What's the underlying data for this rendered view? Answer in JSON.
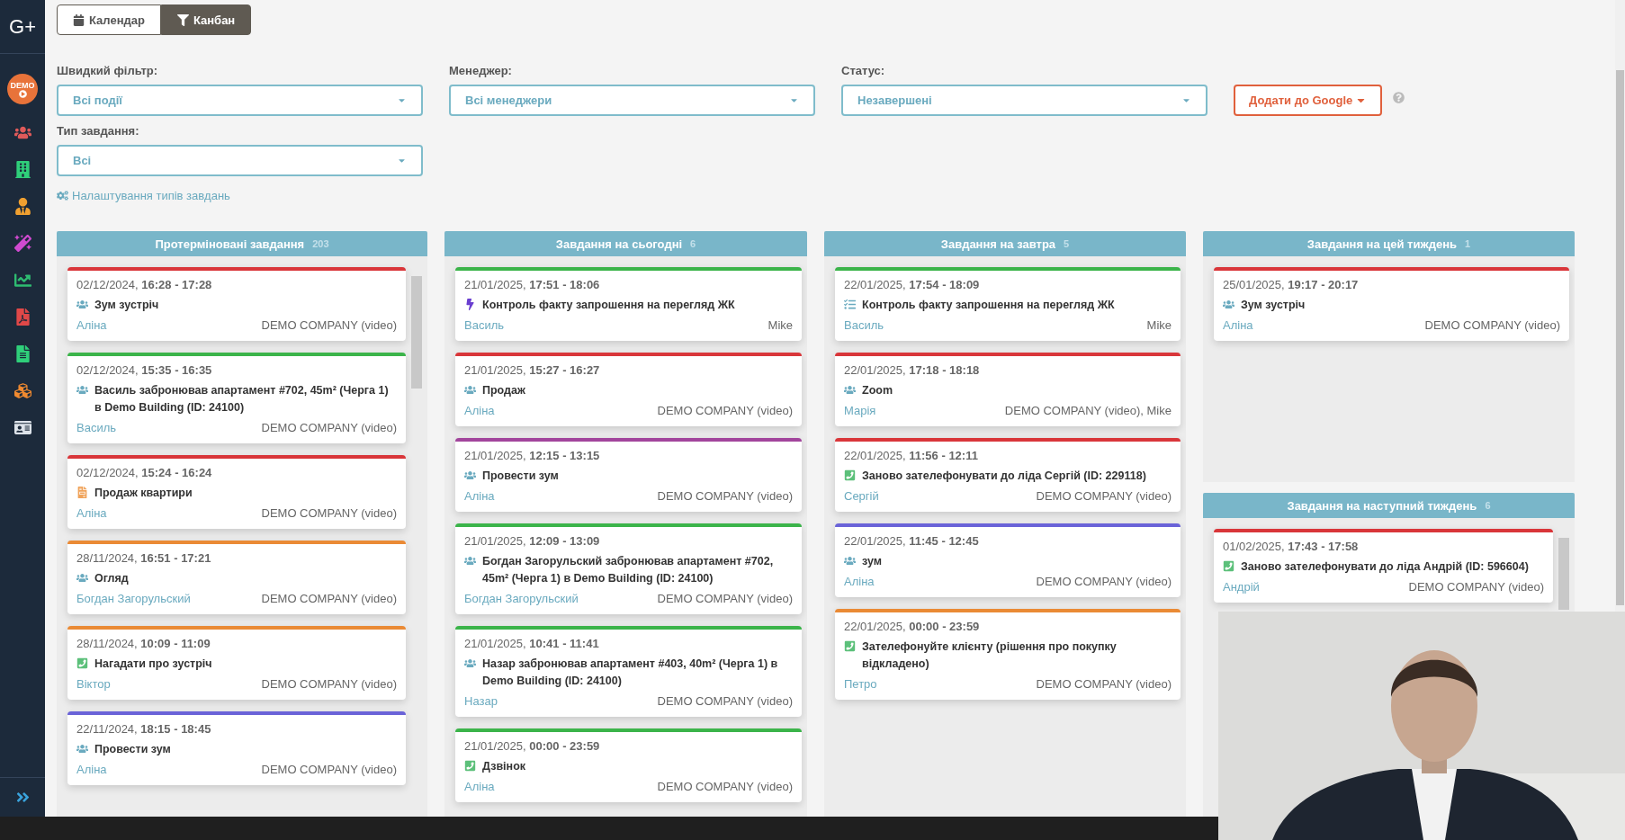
{
  "sidebar": {
    "logo": "G+",
    "avatar": "DEMO"
  },
  "view_toggle": [
    {
      "label": "Календар",
      "kind": "calendar",
      "selected": false
    },
    {
      "label": "Канбан",
      "kind": "filter",
      "selected": true
    }
  ],
  "filters": [
    {
      "label": "Швидкий фільтр:",
      "value": "Всі події"
    },
    {
      "label": "Менеджер:",
      "value": "Всі менеджери"
    },
    {
      "label": "Статус:",
      "value": "Незавершені"
    },
    {
      "label": "Тип завдання:",
      "value": "Всі"
    }
  ],
  "google_button": "Додати до Google",
  "settings_link": "Налаштування типів завдань",
  "columns": [
    {
      "sections": [
        {
          "title": "Протерміновані завдання",
          "count": "203",
          "scrollbar": true,
          "cards": [
            {
              "color": "#d9363a",
              "when": "02/12/2024, **16:28 - 17:28**",
              "kind": "meeting",
              "title": "Зум зустріч",
              "manager": "Аліна",
              "company": "DEMO COMPANY (video)"
            },
            {
              "color": "#3bb44a",
              "when": "02/12/2024, **15:35 - 16:35**",
              "kind": "meeting",
              "title": "Василь забронював апартамент #702, 45m² (Черга 1) в Demo Building (ID: 24100)",
              "manager": "Василь",
              "company": "DEMO COMPANY (video)"
            },
            {
              "color": "#d9363a",
              "when": "02/12/2024, **15:24 - 16:24**",
              "kind": "document",
              "title": "Продаж квартири",
              "manager": "Аліна",
              "company": "DEMO COMPANY (video)"
            },
            {
              "color": "#ea8a35",
              "when": "28/11/2024, **16:51 - 17:21**",
              "kind": "meeting",
              "title": "Огляд",
              "manager": "Богдан Загорульский",
              "company": "DEMO COMPANY (video)"
            },
            {
              "color": "#ea8a35",
              "when": "28/11/2024, **10:09 - 11:09**",
              "kind": "call",
              "title": "Нагадати про зустріч",
              "manager": "Віктор",
              "company": "DEMO COMPANY (video)"
            },
            {
              "color": "#6a63d8",
              "when": "22/11/2024, **18:15 - 18:45**",
              "kind": "meeting",
              "title": "Провести зум",
              "manager": "Аліна",
              "company": "DEMO COMPANY (video)"
            }
          ]
        }
      ]
    },
    {
      "sections": [
        {
          "title": "Завдання на сьогодні",
          "count": "6",
          "scrollbar": false,
          "cards": [
            {
              "color": "#3bb44a",
              "when": "21/01/2025, **17:51 - 18:06**",
              "kind": "bolt",
              "title": "Контроль факту запрошення на перегляд ЖК",
              "manager": "Василь",
              "company": "Mike"
            },
            {
              "color": "#d9363a",
              "when": "21/01/2025, **15:27 - 16:27**",
              "kind": "meeting",
              "title": "Продаж",
              "manager": "Аліна",
              "company": "DEMO COMPANY (video)"
            },
            {
              "color": "#a2459c",
              "when": "21/01/2025, **12:15 - 13:15**",
              "kind": "meeting",
              "title": "Провести зум",
              "manager": "Аліна",
              "company": "DEMO COMPANY (video)"
            },
            {
              "color": "#3bb44a",
              "when": "21/01/2025, **12:09 - 13:09**",
              "kind": "meeting",
              "title": "Богдан Загорульский забронював апартамент #702, 45m² (Черга 1) в Demo Building (ID: 24100)",
              "manager": "Богдан Загорульский",
              "company": "DEMO COMPANY (video)"
            },
            {
              "color": "#3bb44a",
              "when": "21/01/2025, **10:41 - 11:41**",
              "kind": "meeting",
              "title": "Назар забронював апартамент #403, 40m² (Черга 1) в Demo Building (ID: 24100)",
              "manager": "Назар",
              "company": "DEMO COMPANY (video)"
            },
            {
              "color": "#3bb44a",
              "when": "21/01/2025, **00:00 - 23:59**",
              "kind": "call",
              "title": "Дзвінок",
              "manager": "Аліна",
              "company": "DEMO COMPANY (video)"
            }
          ]
        }
      ]
    },
    {
      "sections": [
        {
          "title": "Завдання на завтра",
          "count": "5",
          "scrollbar": false,
          "cards": [
            {
              "color": "#3bb44a",
              "when": "22/01/2025, **17:54 - 18:09**",
              "kind": "list",
              "title": "Контроль факту запрошення на перегляд ЖК",
              "manager": "Василь",
              "company": "Mike"
            },
            {
              "color": "#d9363a",
              "when": "22/01/2025, **17:18 - 18:18**",
              "kind": "meeting",
              "title": "Zoom",
              "manager": "Марія",
              "company": "DEMO COMPANY (video), Mike"
            },
            {
              "color": "#d9363a",
              "when": "22/01/2025, **11:56 - 12:11**",
              "kind": "call",
              "title": "Заново зателефонувати до ліда Сергій (ID: 229118)",
              "manager": "Сергій",
              "company": "DEMO COMPANY (video)"
            },
            {
              "color": "#6a63d8",
              "when": "22/01/2025, **11:45 - 12:45**",
              "kind": "meeting",
              "title": "зум",
              "manager": "Аліна",
              "company": "DEMO COMPANY (video)"
            },
            {
              "color": "#ea8a35",
              "when": "22/01/2025, **00:00 - 23:59**",
              "kind": "call",
              "title": "Зателефонуйте клієнту (рішення про покупку відкладено)",
              "manager": "Петро",
              "company": "DEMO COMPANY (video)"
            }
          ]
        }
      ]
    },
    {
      "sections": [
        {
          "title": "Завдання на цей тиждень",
          "count": "1",
          "scrollbar": false,
          "cards": [
            {
              "color": "#d9363a",
              "when": "25/01/2025, **19:17 - 20:17**",
              "kind": "meeting",
              "title": "Зум зустріч",
              "manager": "Аліна",
              "company": "DEMO COMPANY (video)"
            }
          ]
        },
        {
          "title": "Завдання на наступний тиждень",
          "count": "6",
          "scrollbar": true,
          "cards": [
            {
              "color": "#d9363a",
              "when": "01/02/2025, **17:43 - 17:58**",
              "kind": "call",
              "title": "Заново зателефонувати до ліда Андрій (ID: 596604)",
              "manager": "Андрій",
              "company": "DEMO COMPANY (video)"
            }
          ]
        }
      ]
    }
  ]
}
